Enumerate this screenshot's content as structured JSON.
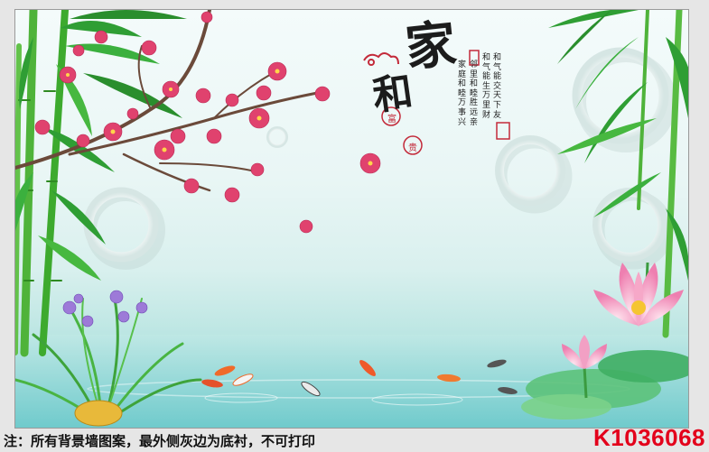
{
  "calligraphy": {
    "char_jia": "家",
    "char_he": "和",
    "seal_fu": "富",
    "seal_gui": "贵",
    "poem_columns": [
      "和气能交天下友",
      "和气能生万里财",
      "邻里和睦胜远亲",
      "家庭和睦万事兴"
    ]
  },
  "footer": {
    "note": "注：所有背景墙图案，最外侧灰边为底衬，不可打印",
    "product_code": "K1036068"
  },
  "colors": {
    "background_border": "#e6e6e6",
    "code_red": "#e3001b",
    "seal_red": "#c32a3a",
    "bamboo_green": "#3daa2e",
    "blossom_pink": "#e0426e",
    "water": "#86d3d2"
  }
}
